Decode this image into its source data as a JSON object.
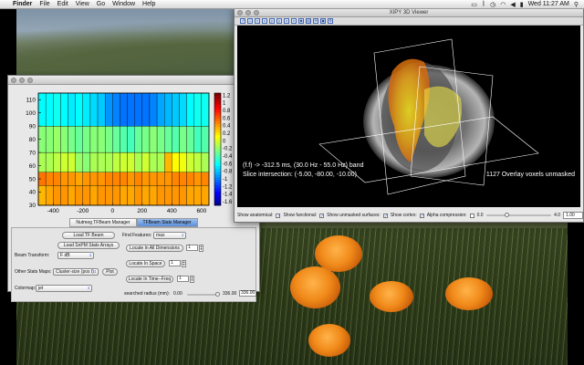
{
  "menubar": {
    "apple_glyph": "",
    "app_name": "Finder",
    "items": [
      "File",
      "Edit",
      "View",
      "Go",
      "Window",
      "Help"
    ],
    "clock": "Wed 11:27 AM",
    "status_icons": [
      "display-icon",
      "bluetooth-icon",
      "timemachine-icon",
      "wifi-icon",
      "volume-icon",
      "battery-icon",
      "spotlight-icon"
    ]
  },
  "viewer": {
    "title": "XIPY 3D Viewer",
    "toolbar_icons": [
      "pointer-icon",
      "axes-icon",
      "view-x-icon",
      "view-x-neg-icon",
      "view-y-icon",
      "view-y-neg-icon",
      "view-z-icon",
      "view-z-neg-icon",
      "isometric-icon",
      "parallel-icon",
      "fullscreen-icon",
      "save-icon",
      "settings-icon"
    ],
    "overlay_line1": "(f.f) -> -312.5 ms, (30.0 Hz - 55.0 Hz) band",
    "overlay_line2": "Slice intersection: (-5.00, -80.00, -10.00)",
    "overlay_voxels": "1127 Overlay voxels unmasked",
    "controls": {
      "show_anatomical": "Show anatomical:",
      "show_functional": "Show functional:",
      "show_unmasked": "Show unmasked surfaces:",
      "show_cortex": "Show cortex:",
      "alpha_compression": "Alpha compression:",
      "alpha_min": "0.0",
      "alpha_max": "4.0",
      "alpha_value": "1.00",
      "alpha_level": 0.33
    }
  },
  "nutmeg": {
    "tabs": [
      "Nutmeg TFBeam Manager",
      "TFBeam Stats Manager"
    ],
    "active_tab": 1,
    "load_tf_beam": "Load TF Beam",
    "load_snpm": "Load SnPM Stats Arrays",
    "beam_transform_label": "Beam Transform:",
    "beam_transform_value": "F dB",
    "other_stats_label": "Other Stats Maps:",
    "other_stats_value": "Cluster-size (pos t)",
    "plot_button": "Plot",
    "colormap_label": "Colormap:",
    "colormap_value": "jet",
    "find_features_label": "Find Features:",
    "find_features_value": "max",
    "locate_all": "Locate In All Dimensions",
    "locate_all_value": "1",
    "locate_space": "Locate In Space",
    "locate_space_value": "1",
    "locate_time_freq": "Locate In Time--Freq",
    "locate_time_freq_value": "1",
    "searched_radius_label": "searched radius (mm):",
    "radius_min": "0.00",
    "radius_max": "336.00",
    "radius_value": "336.00",
    "radius_level": 1.0
  },
  "chart_data": {
    "type": "heatmap",
    "xlabel": "",
    "ylabel": "",
    "x_ticks": [
      -400,
      -200,
      0,
      200,
      400,
      600
    ],
    "y_ticks": [
      30,
      40,
      50,
      60,
      70,
      80,
      90,
      100,
      110
    ],
    "xlim": [
      -500,
      650
    ],
    "ylim": [
      30,
      115
    ],
    "colorbar_ticks": [
      "1.2",
      "1",
      "0.8",
      "0.6",
      "0.4",
      "0.2",
      "0",
      "-0.2",
      "-0.4",
      "-0.6",
      "-0.8",
      "-1",
      "-1.2",
      "-1.4",
      "-1.6"
    ],
    "clim": [
      -1.7,
      1.25
    ],
    "colormap": "jet",
    "time_bins": [
      -475,
      -425,
      -375,
      -325,
      -275,
      -225,
      -175,
      -125,
      -75,
      -25,
      25,
      75,
      125,
      175,
      225,
      275,
      325,
      375,
      425,
      475,
      525,
      575,
      625
    ],
    "freq_bands": [
      {
        "low": 30,
        "high": 45,
        "values": [
          0.35,
          0.4,
          0.45,
          0.45,
          0.4,
          0.45,
          0.45,
          0.4,
          0.45,
          0.45,
          0.45,
          0.4,
          0.4,
          0.45,
          0.4,
          0.4,
          0.45,
          0.45,
          0.45,
          0.45,
          0.4,
          0.4,
          0.4
        ]
      },
      {
        "low": 45,
        "high": 55,
        "values": [
          0.55,
          0.5,
          0.5,
          0.45,
          0.45,
          0.4,
          0.45,
          0.45,
          0.45,
          0.5,
          0.5,
          0.5,
          0.45,
          0.5,
          0.45,
          0.45,
          0.45,
          0.45,
          0.5,
          0.5,
          0.5,
          0.45,
          0.5
        ]
      },
      {
        "low": 55,
        "high": 70,
        "values": [
          -0.1,
          -0.1,
          -0.05,
          0.0,
          0.0,
          -0.15,
          -0.2,
          -0.1,
          -0.1,
          -0.1,
          -0.05,
          0.0,
          0.0,
          -0.1,
          0.0,
          -0.1,
          -0.1,
          0.35,
          0.15,
          0.1,
          0.0,
          -0.05,
          -0.1
        ]
      },
      {
        "low": 70,
        "high": 90,
        "values": [
          -0.2,
          -0.2,
          -0.15,
          -0.2,
          -0.25,
          -0.3,
          -0.25,
          -0.2,
          -0.2,
          -0.25,
          -0.3,
          -0.35,
          -0.4,
          -0.3,
          -0.25,
          -0.2,
          -0.25,
          -0.3,
          -0.35,
          -0.25,
          -0.3,
          -0.4,
          -0.35
        ]
      },
      {
        "low": 90,
        "high": 115,
        "values": [
          -0.6,
          -0.6,
          -0.55,
          -0.6,
          -0.65,
          -0.6,
          -0.65,
          -0.7,
          -0.75,
          -0.9,
          -0.95,
          -1.0,
          -1.0,
          -1.0,
          -1.0,
          -0.95,
          -0.85,
          -0.8,
          -0.75,
          -0.7,
          -0.6,
          -0.55,
          -0.55
        ]
      }
    ]
  }
}
